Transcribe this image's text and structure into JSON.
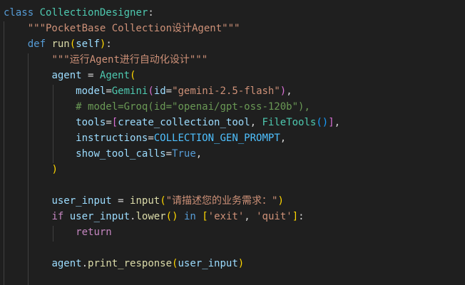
{
  "code": {
    "lines": [
      [
        {
          "t": "class",
          "c": "kw"
        },
        {
          "t": " ",
          "c": "op"
        },
        {
          "t": "CollectionDesigner",
          "c": "cls"
        },
        {
          "t": ":",
          "c": "op"
        }
      ],
      [
        {
          "t": "    ",
          "c": "op"
        },
        {
          "t": "\"\"\"PocketBase Collection设计Agent\"\"\"",
          "c": "str"
        }
      ],
      [
        {
          "t": "    ",
          "c": "op"
        },
        {
          "t": "def",
          "c": "kw"
        },
        {
          "t": " ",
          "c": "op"
        },
        {
          "t": "run",
          "c": "fn"
        },
        {
          "t": "(",
          "c": "p1"
        },
        {
          "t": "self",
          "c": "var"
        },
        {
          "t": ")",
          "c": "p1"
        },
        {
          "t": ":",
          "c": "op"
        }
      ],
      [
        {
          "t": "        ",
          "c": "op"
        },
        {
          "t": "\"\"\"运行Agent进行自动化设计\"\"\"",
          "c": "str"
        }
      ],
      [
        {
          "t": "        ",
          "c": "op"
        },
        {
          "t": "agent",
          "c": "var"
        },
        {
          "t": " = ",
          "c": "op"
        },
        {
          "t": "Agent",
          "c": "cls"
        },
        {
          "t": "(",
          "c": "p1"
        }
      ],
      [
        {
          "t": "            ",
          "c": "op"
        },
        {
          "t": "model",
          "c": "var"
        },
        {
          "t": "=",
          "c": "op"
        },
        {
          "t": "Gemini",
          "c": "cls"
        },
        {
          "t": "(",
          "c": "p2"
        },
        {
          "t": "id",
          "c": "var"
        },
        {
          "t": "=",
          "c": "op"
        },
        {
          "t": "\"gemini-2.5-flash\"",
          "c": "str"
        },
        {
          "t": ")",
          "c": "p2"
        },
        {
          "t": ",",
          "c": "op"
        }
      ],
      [
        {
          "t": "            ",
          "c": "op"
        },
        {
          "t": "# model=Groq(id=\"openai/gpt-oss-120b\"),",
          "c": "cmt"
        }
      ],
      [
        {
          "t": "            ",
          "c": "op"
        },
        {
          "t": "tools",
          "c": "var"
        },
        {
          "t": "=",
          "c": "op"
        },
        {
          "t": "[",
          "c": "p2"
        },
        {
          "t": "create_collection_tool",
          "c": "var"
        },
        {
          "t": ", ",
          "c": "op"
        },
        {
          "t": "FileTools",
          "c": "cls"
        },
        {
          "t": "(",
          "c": "p3"
        },
        {
          "t": ")",
          "c": "p3"
        },
        {
          "t": "]",
          "c": "p2"
        },
        {
          "t": ",",
          "c": "op"
        }
      ],
      [
        {
          "t": "            ",
          "c": "op"
        },
        {
          "t": "instructions",
          "c": "var"
        },
        {
          "t": "=",
          "c": "op"
        },
        {
          "t": "COLLECTION_GEN_PROMPT",
          "c": "const"
        },
        {
          "t": ",",
          "c": "op"
        }
      ],
      [
        {
          "t": "            ",
          "c": "op"
        },
        {
          "t": "show_tool_calls",
          "c": "var"
        },
        {
          "t": "=",
          "c": "op"
        },
        {
          "t": "True",
          "c": "kw"
        },
        {
          "t": ",",
          "c": "op"
        }
      ],
      [
        {
          "t": "        ",
          "c": "op"
        },
        {
          "t": ")",
          "c": "p1"
        }
      ],
      [],
      [
        {
          "t": "        ",
          "c": "op"
        },
        {
          "t": "user_input",
          "c": "var"
        },
        {
          "t": " = ",
          "c": "op"
        },
        {
          "t": "input",
          "c": "fn"
        },
        {
          "t": "(",
          "c": "p1"
        },
        {
          "t": "\"请描述您的业务需求：\"",
          "c": "str"
        },
        {
          "t": ")",
          "c": "p1"
        }
      ],
      [
        {
          "t": "        ",
          "c": "op"
        },
        {
          "t": "if",
          "c": "kw2"
        },
        {
          "t": " ",
          "c": "op"
        },
        {
          "t": "user_input",
          "c": "var"
        },
        {
          "t": ".",
          "c": "op"
        },
        {
          "t": "lower",
          "c": "fn"
        },
        {
          "t": "(",
          "c": "p1"
        },
        {
          "t": ")",
          "c": "p1"
        },
        {
          "t": " ",
          "c": "op"
        },
        {
          "t": "in",
          "c": "kw"
        },
        {
          "t": " ",
          "c": "op"
        },
        {
          "t": "[",
          "c": "p1"
        },
        {
          "t": "'exit'",
          "c": "str"
        },
        {
          "t": ", ",
          "c": "op"
        },
        {
          "t": "'quit'",
          "c": "str"
        },
        {
          "t": "]",
          "c": "p1"
        },
        {
          "t": ":",
          "c": "op"
        }
      ],
      [
        {
          "t": "            ",
          "c": "op"
        },
        {
          "t": "return",
          "c": "kw2"
        }
      ],
      [],
      [
        {
          "t": "        ",
          "c": "op"
        },
        {
          "t": "agent",
          "c": "var"
        },
        {
          "t": ".",
          "c": "op"
        },
        {
          "t": "print_response",
          "c": "fn"
        },
        {
          "t": "(",
          "c": "p1"
        },
        {
          "t": "user_input",
          "c": "var"
        },
        {
          "t": ")",
          "c": "p1"
        }
      ]
    ]
  }
}
